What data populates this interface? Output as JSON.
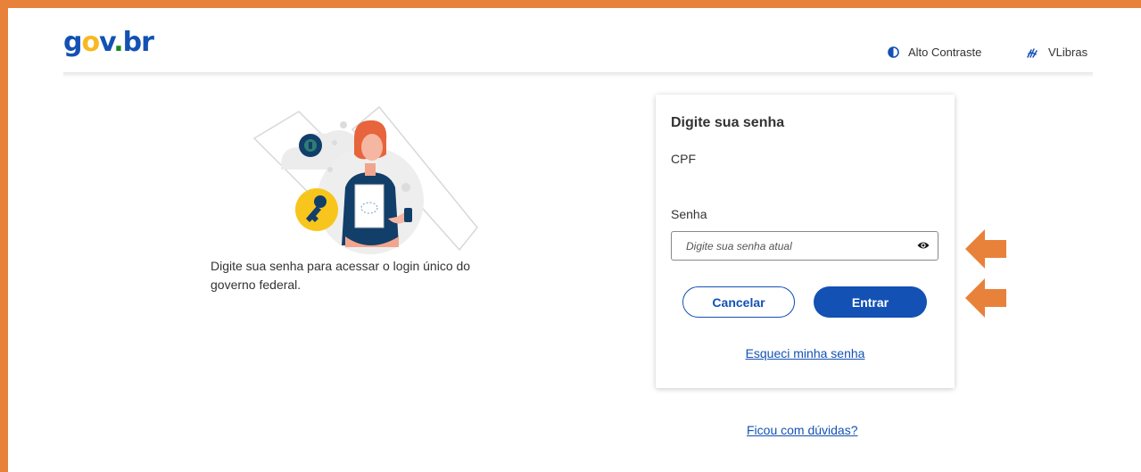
{
  "header": {
    "logo_text": "gov.br",
    "high_contrast_label": "Alto Contraste",
    "vlibras_label": "VLibras"
  },
  "intro": {
    "text": "Digite sua senha para acessar o login único do governo federal."
  },
  "login_card": {
    "title": "Digite sua senha",
    "cpf_label": "CPF",
    "password_label": "Senha",
    "password_placeholder": "Digite sua senha atual",
    "password_value": "",
    "cancel_label": "Cancelar",
    "submit_label": "Entrar",
    "forgot_link": "Esqueci minha senha"
  },
  "help_link": "Ficou com dúvidas?",
  "colors": {
    "primary": "#1351b4",
    "annotation_orange": "#e8823a",
    "logo_yellow": "#f8b920",
    "logo_green": "#168821"
  }
}
